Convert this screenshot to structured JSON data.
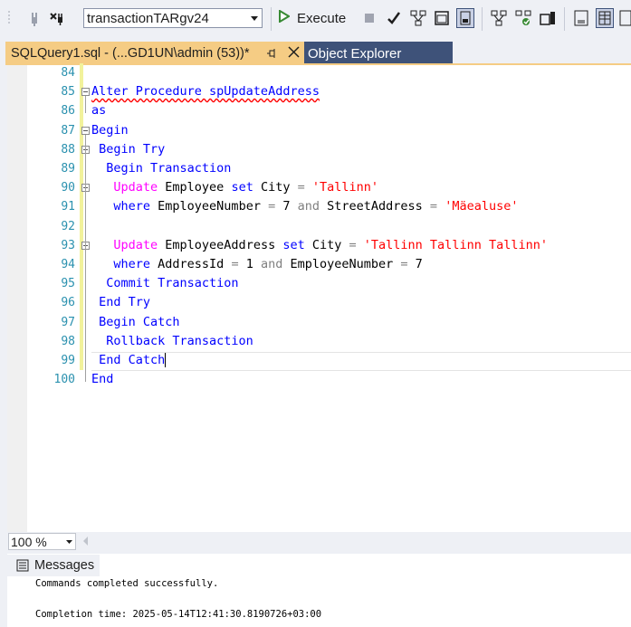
{
  "toolbar": {
    "database": "transactionTARgv24",
    "execute_label": "Execute"
  },
  "tabs": {
    "active_label": "SQLQuery1.sql - (...GD1UN\\admin (53))*",
    "other_label": "Object Explorer"
  },
  "editor": {
    "lines": [
      {
        "n": "84",
        "parts": []
      },
      {
        "n": "85",
        "parts": [
          {
            "t": "Alter Procedure spUpdateAddress",
            "c": "kw squiggle"
          }
        ]
      },
      {
        "n": "86",
        "parts": [
          {
            "t": "as",
            "c": "kw"
          }
        ]
      },
      {
        "n": "87",
        "parts": [
          {
            "t": "Begin",
            "c": "kw"
          }
        ]
      },
      {
        "n": "88",
        "parts": [
          {
            "t": " Begin Try",
            "c": "kw"
          }
        ]
      },
      {
        "n": "89",
        "parts": [
          {
            "t": "  Begin Transaction",
            "c": "kw"
          }
        ]
      },
      {
        "n": "90",
        "parts": [
          {
            "t": "   Update",
            "c": "fn"
          },
          {
            "t": " Employee ",
            "c": ""
          },
          {
            "t": "set",
            "c": "kw"
          },
          {
            "t": " City ",
            "c": ""
          },
          {
            "t": "=",
            "c": "op"
          },
          {
            "t": " ",
            "c": ""
          },
          {
            "t": "'Tallinn'",
            "c": "str"
          }
        ]
      },
      {
        "n": "91",
        "parts": [
          {
            "t": "   where",
            "c": "kw"
          },
          {
            "t": " EmployeeNumber ",
            "c": ""
          },
          {
            "t": "=",
            "c": "op"
          },
          {
            "t": " 7 ",
            "c": ""
          },
          {
            "t": "and",
            "c": "op"
          },
          {
            "t": " StreetAddress ",
            "c": ""
          },
          {
            "t": "=",
            "c": "op"
          },
          {
            "t": " ",
            "c": ""
          },
          {
            "t": "'Mäealuse'",
            "c": "str"
          }
        ]
      },
      {
        "n": "92",
        "parts": []
      },
      {
        "n": "93",
        "parts": [
          {
            "t": "   Update",
            "c": "fn"
          },
          {
            "t": " EmployeeAddress ",
            "c": ""
          },
          {
            "t": "set",
            "c": "kw"
          },
          {
            "t": " City ",
            "c": ""
          },
          {
            "t": "=",
            "c": "op"
          },
          {
            "t": " ",
            "c": ""
          },
          {
            "t": "'Tallinn Tallinn Tallinn'",
            "c": "str"
          }
        ]
      },
      {
        "n": "94",
        "parts": [
          {
            "t": "   where",
            "c": "kw"
          },
          {
            "t": " AddressId ",
            "c": ""
          },
          {
            "t": "=",
            "c": "op"
          },
          {
            "t": " 1 ",
            "c": ""
          },
          {
            "t": "and",
            "c": "op"
          },
          {
            "t": " EmployeeNumber ",
            "c": ""
          },
          {
            "t": "=",
            "c": "op"
          },
          {
            "t": " 7",
            "c": ""
          }
        ]
      },
      {
        "n": "95",
        "parts": [
          {
            "t": "  Commit Transaction",
            "c": "kw"
          }
        ]
      },
      {
        "n": "96",
        "parts": [
          {
            "t": " End Try",
            "c": "kw"
          }
        ]
      },
      {
        "n": "97",
        "parts": [
          {
            "t": " Begin Catch",
            "c": "kw"
          }
        ]
      },
      {
        "n": "98",
        "parts": [
          {
            "t": "  Rollback Transaction",
            "c": "kw"
          }
        ]
      },
      {
        "n": "99",
        "parts": [
          {
            "t": " End Catch",
            "c": "kw"
          }
        ]
      },
      {
        "n": "100",
        "parts": [
          {
            "t": "End",
            "c": "kw"
          }
        ]
      }
    ]
  },
  "status": {
    "zoom": "100 %"
  },
  "results": {
    "tab_label": "Messages",
    "line1": "Commands completed successfully.",
    "line2": "Completion time: 2025-05-14T12:41:30.8190726+03:00"
  },
  "colors": {
    "accent_tab": "#f5cc84",
    "inactive_tab": "#3e5279",
    "keyword": "#0000ff",
    "string": "#ff0000",
    "function": "#ff00ff"
  }
}
